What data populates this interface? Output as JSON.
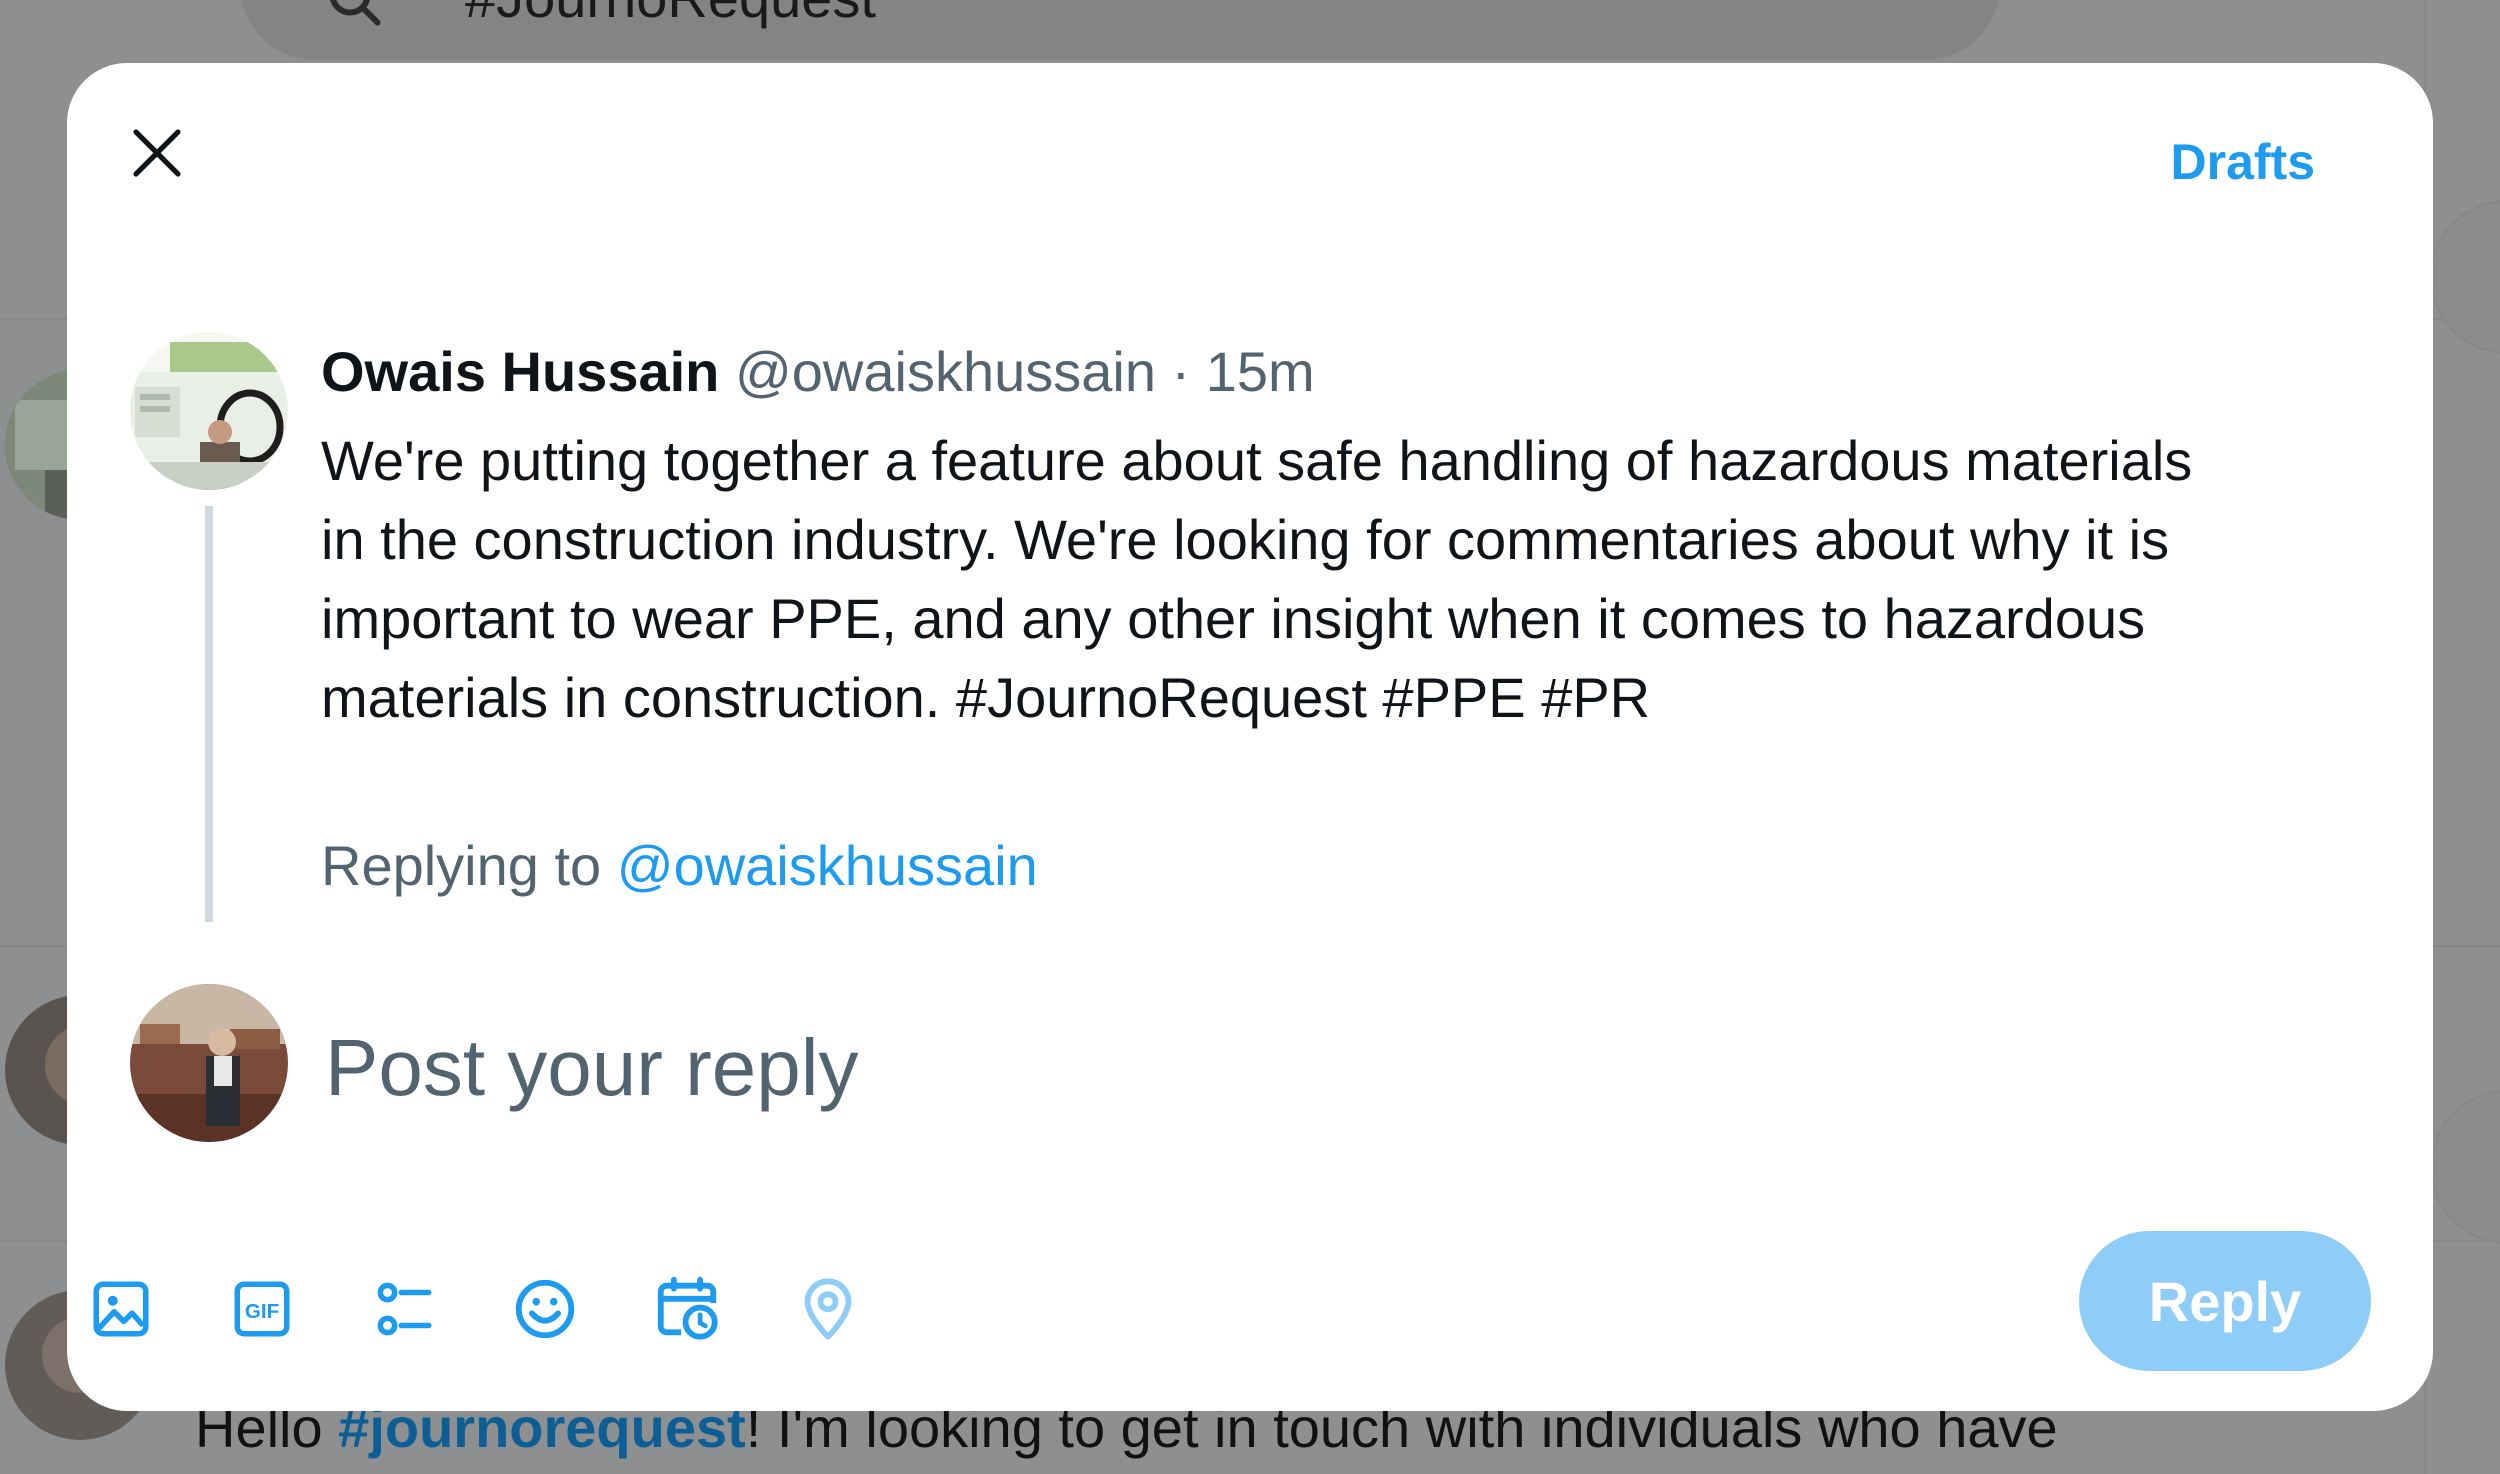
{
  "background": {
    "search_text": "#JournoRequest",
    "tweet_snippet_prefix": "Hello ",
    "tweet_snippet_tag": "#journorequest",
    "tweet_snippet_suffix": "! I'm looking to get in touch with individuals who have"
  },
  "modal": {
    "close_icon": "close-icon",
    "drafts_label": "Drafts",
    "original_post": {
      "author_name": "Owais Hussain",
      "author_handle": "@owaiskhussain",
      "separator": "·",
      "time": "15m",
      "text": "We're putting together a feature about safe handling of hazardous materials\nin the construction industry. We're looking for commentaries about why it is\nimportant to wear PPE, and any other insight when it comes to hazardous\nmaterials in construction. #JournoRequest #PPE #PR"
    },
    "replying_to": {
      "prefix": "Replying to ",
      "handle": "@owaiskhussain"
    },
    "composer": {
      "placeholder": "Post your reply",
      "value": ""
    },
    "toolbar": {
      "icons": [
        "image-icon",
        "gif-icon",
        "poll-icon",
        "emoji-icon",
        "schedule-icon",
        "location-icon"
      ],
      "gif_text": "GIF"
    },
    "reply_button_label": "Reply",
    "colors": {
      "accent": "#1d9bf0",
      "reply_button_disabled": "#8ecdf8",
      "secondary_text": "#536471",
      "primary_text": "#0f1419",
      "thread_line": "#cfd9de",
      "overlay_background": "#8d8f90"
    }
  }
}
